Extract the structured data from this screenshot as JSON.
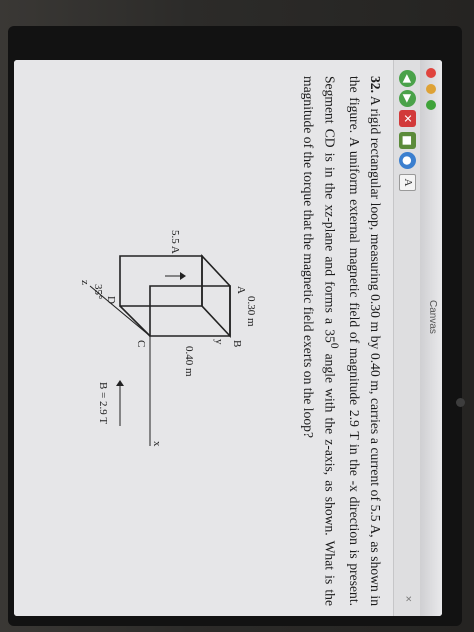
{
  "window": {
    "title": "Canvas",
    "close_label": "×",
    "toolbar_icons": [
      "back-icon",
      "forward-icon",
      "stop-icon",
      "app-icon",
      "globe-icon",
      "font-icon"
    ],
    "font_button_label": "A"
  },
  "problem": {
    "number": "32.",
    "text": "A rigid rectangular loop, measuring 0.30 m by 0.40 m, carries a current of 5.5 A, as shown in the figure. A uniform external magnetic field of magnitude 2.9 T in the -x direction is present. Segment CD is in the xz-plane and forms a 35",
    "degree": "0",
    "text_end": "angle with the z-axis, as shown. What is the magnitude of the torque that the magnetic field exerts on the loop?"
  },
  "figure": {
    "label_y": "y",
    "label_x": "x",
    "label_z": "z",
    "label_A": "A",
    "label_B": "B",
    "label_C": "C",
    "label_D": "D",
    "label_width": "0.30 m",
    "label_height": "0.40 m",
    "label_current": "5.5 A",
    "label_angle": "35°",
    "label_field": "B = 2.9 T"
  }
}
